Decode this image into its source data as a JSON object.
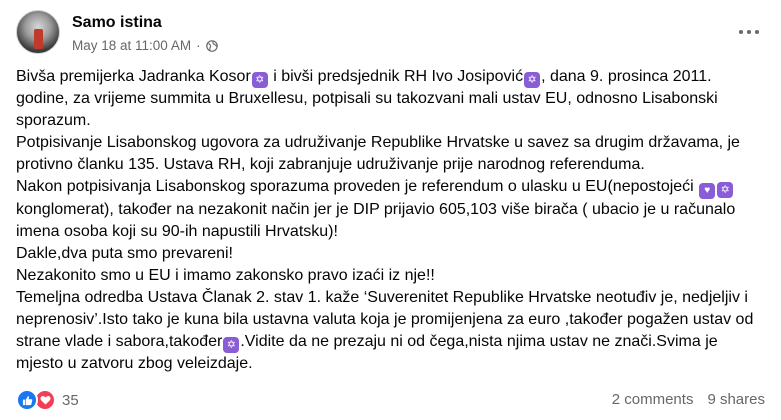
{
  "post": {
    "author": "Samo istina",
    "timestamp": "May 18 at 11:00 AM",
    "separator": "·",
    "privacy_icon": "globe-icon",
    "more_icon": "more-dots-icon"
  },
  "body": {
    "line1a": "Bivša premijerka Jadranka Kosor",
    "line1b": " i bivši predsjednik RH Ivo Josipović",
    "line1c": ", dana 9. prosinca 2011. godine, za vrijeme summita u Bruxellesu, potpisali su takozvani mali ustav EU, odnosno Lisabonski sporazum.",
    "para2": "Potpisivanje Lisabonskog ugovora za udruživanje Republike Hrvatske u savez sa drugim državama, je protivno članku 135. Ustava RH, koji zabranjuje udruživanje prije narodnog referenduma.",
    "para3a": "Nakon potpisivanja Lisabonskog sporazuma proveden je referendum o ulasku u EU(nepostojeći ",
    "para3b": " konglomerat), također na nezakonit način jer je DIP prijavio 605,103 više birača ( ubacio je u računalo imena osoba koji su 90-ih napustili Hrvatsku)!",
    "para4": "Dakle,dva puta smo prevareni!",
    "para5": "Nezakonito smo u EU i imamo zakonsko pravo izaći iz nje!!",
    "para6a": "Temeljna odredba Ustava Članak 2. stav 1. kaže ‘Suverenitet Republike Hrvatske neotuđiv je, nedjeljiv i neprenosiv’.Isto tako  je  kuna bila ustavna valuta koja je promijenjena za euro ,također pogažen ustav od strane vlade i sabora,također",
    "para6b": ".Vidite da  ne prezaju ni od čega,nista njima ustav ne znači.Svima je mjesto u zatvoru zbog veleizdaje.",
    "emoji_glyph": "✡",
    "heart_glyph": "♥"
  },
  "footer": {
    "reaction_count": "35",
    "comments": "2 comments",
    "shares": "9 shares",
    "colors": {
      "like": "#1877f2",
      "love": "#f33e58"
    }
  }
}
